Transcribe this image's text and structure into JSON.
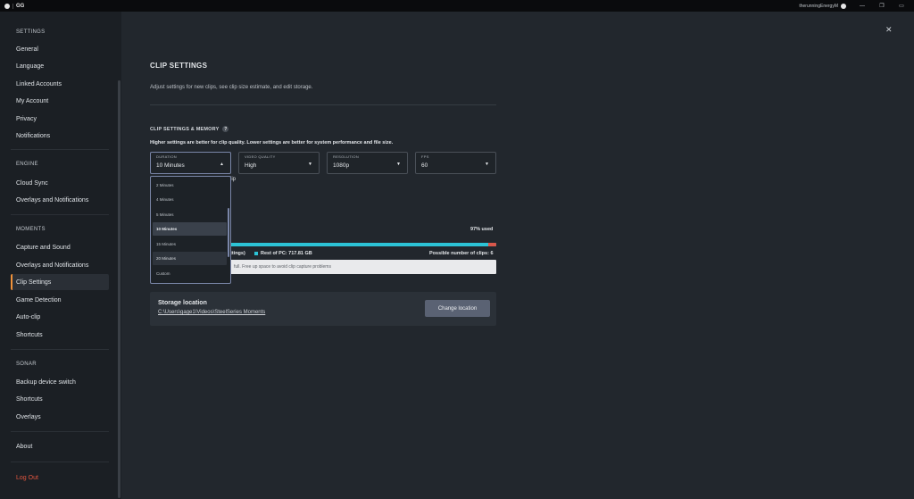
{
  "titlebar": {
    "app_name": "GG",
    "username": "therunningEnergyM"
  },
  "sidebar": {
    "settings_heading": "SETTINGS",
    "settings_items": [
      "General",
      "Language",
      "Linked Accounts",
      "My Account",
      "Privacy",
      "Notifications"
    ],
    "engine_heading": "ENGINE",
    "engine_items": [
      "Cloud Sync",
      "Overlays and Notifications"
    ],
    "moments_heading": "MOMENTS",
    "moments_items": [
      "Capture and Sound",
      "Overlays and Notifications",
      "Clip Settings",
      "Game Detection",
      "Auto-clip",
      "Shortcuts"
    ],
    "sonar_heading": "SONAR",
    "sonar_items": [
      "Backup device switch",
      "Shortcuts",
      "Overlays"
    ],
    "about": "About",
    "logout": "Log Out"
  },
  "main": {
    "title": "CLIP SETTINGS",
    "description": "Adjust settings for new clips, see clip size estimate, and edit storage.",
    "section_title": "CLIP SETTINGS & MEMORY",
    "help": "?",
    "section_desc": "Higher settings are better for clip quality. Lower settings are better for system performance and file size.",
    "fields": {
      "duration": {
        "label": "DURATION",
        "value": "10 Minutes"
      },
      "quality": {
        "label": "VIDEO QUALITY",
        "value": "High"
      },
      "resolution": {
        "label": "RESOLUTION",
        "value": "1080p"
      },
      "fps": {
        "label": "FPS",
        "value": "60"
      }
    },
    "clip_partial": "lip",
    "used": "97% used",
    "legend_partial": "ttings)",
    "legend_rest": "Rest of PC: 717.81 GB",
    "possible_clips": "Possible number of clips: 6",
    "warning": "full. Free up space to avoid clip capture problems",
    "storage": {
      "title": "Storage location",
      "path": "C:\\Users\\gage1\\Videos\\SteelSeries Moments",
      "button": "Change location"
    }
  },
  "dropdown": {
    "options": [
      "2 Minutes",
      "4 Minutes",
      "5 Minutes",
      "10 Minutes",
      "15 Minutes",
      "20 Minutes",
      "Custom"
    ]
  },
  "colors": {
    "accent": "#f0923a",
    "bar": "#2cc3d6",
    "bar_full": "#d9574b",
    "logout": "#e2553f"
  }
}
